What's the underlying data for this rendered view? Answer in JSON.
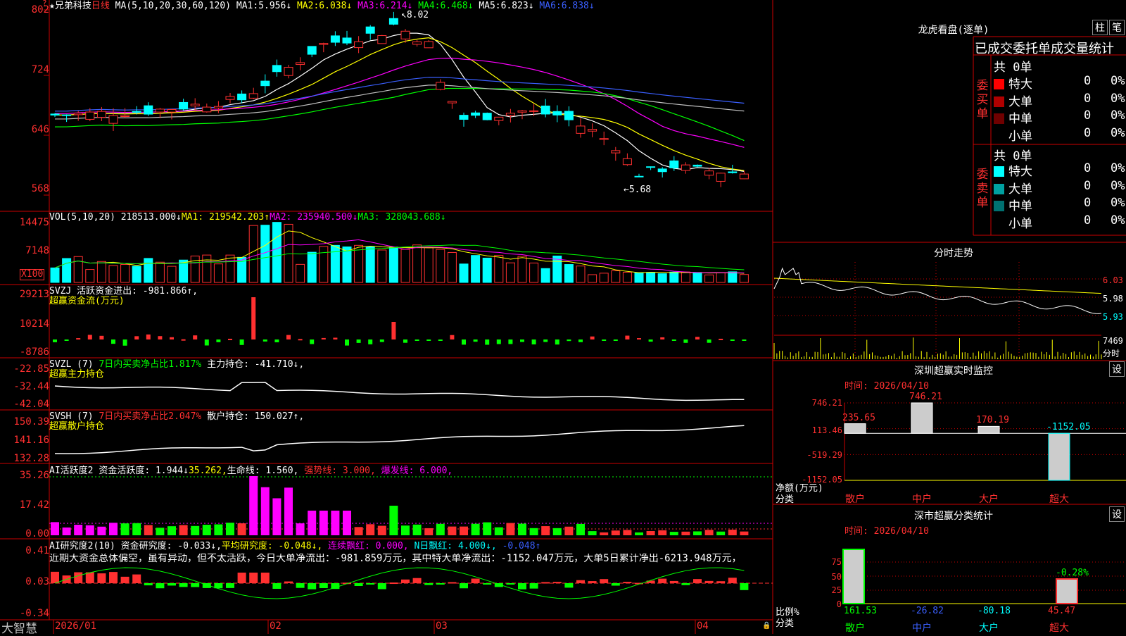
{
  "colors": {
    "up": "#ff3030",
    "down": "#00ffff",
    "grid": "#cc0000",
    "ma1": "#ffffff",
    "ma2": "#ffff00",
    "ma3": "#ff00ff",
    "ma4": "#00ff00",
    "ma5": "#3a5fff",
    "ma6": "#c0c0c0"
  },
  "kline": {
    "stock_name": "★兄弟科技",
    "period": "日线",
    "ma_label": "MA(5,10,20,30,60,120)",
    "ma_values": [
      {
        "label": "MA1:",
        "value": "5.956↓"
      },
      {
        "label": "MA2:",
        "value": "6.038↓"
      },
      {
        "label": "MA3:",
        "value": "6.214↓"
      },
      {
        "label": "MA4:",
        "value": "6.468↓"
      },
      {
        "label": "MA5:",
        "value": "6.823↓"
      },
      {
        "label": "MA6:",
        "value": "6.838↓"
      }
    ],
    "y_ticks": [
      "802",
      "724",
      "646",
      "568"
    ],
    "high_label": "8.02",
    "low_label": "5.68"
  },
  "vol": {
    "title": "VOL(5,10,20)",
    "value": "218513.000↓",
    "ma1": "MA1: 219542.203↑",
    "ma2": "MA2: 235940.500↓",
    "ma3": "MA3: 328043.688↓",
    "y_ticks": [
      "14475",
      "7148"
    ],
    "unit": "X100"
  },
  "svzj": {
    "title": "SVZJ",
    "desc": "活跃资金进出: -981.866↑,",
    "sub": "超赢资金流(万元)",
    "y_ticks": [
      "29213",
      "10214",
      "-8786"
    ]
  },
  "svzl": {
    "title": "SVZL (7)",
    "desc": "7日内买卖净占比1.817%",
    "desc2": "主力持仓: -41.710↓,",
    "sub": "超赢主力持仓",
    "y_ticks": [
      "-22.85",
      "-32.44",
      "-42.04"
    ]
  },
  "svsh": {
    "title": "SVSH (7)",
    "desc": "7日内买卖净占比2.047%",
    "desc2": "散户持仓: 150.027↑,",
    "sub": "超赢散户持仓",
    "y_ticks": [
      "150.39",
      "141.16",
      "132.28"
    ]
  },
  "ai1": {
    "title": "AI活跃度2",
    "a": "资金活跃度: 1.944↓",
    "b": "35.262,",
    "c": "生命线: 1.560,",
    "d": "强势线: 3.000,",
    "e": "爆发线: 6.000,",
    "y_ticks": [
      "35.26",
      "17.42",
      "0.00"
    ]
  },
  "ai2": {
    "title": "AI研究度2(10)",
    "a": "资金研究度: -0.033↓,",
    "b": "平均研究度: -0.048↓,",
    "c": "连续飘红: 0.000,",
    "d": "N日飘红: 4.000↓,",
    "e": "-0.048↑",
    "summary": "近期大资金总体偏空，虽有异动，但不太活跃，今日大单净流出：-981.859万元，其中特大单净流出：-1152.047万元，大单5日累计净出-6213.948万元，",
    "y_ticks": [
      "0.41",
      "0.03",
      "-0.34"
    ]
  },
  "dates": {
    "brand": "大智慧",
    "labels": [
      "2026/01",
      "02",
      "03",
      "04"
    ]
  },
  "lhb": {
    "title": "龙虎看盘(逐单)",
    "btn1": "柱",
    "btn2": "笔",
    "header": "已成交委托单成交量统计",
    "buy": {
      "side": [
        "委",
        "买",
        "单"
      ],
      "total": "共 0单",
      "rows": [
        {
          "name": "特大",
          "n": "0",
          "p": "0%",
          "c": "#ff0000"
        },
        {
          "name": "大单",
          "n": "0",
          "p": "0%",
          "c": "#b00000"
        },
        {
          "name": "中单",
          "n": "0",
          "p": "0%",
          "c": "#700000"
        },
        {
          "name": "小单",
          "n": "0",
          "p": "0%",
          "c": "#000000"
        }
      ]
    },
    "sell": {
      "side": [
        "委",
        "卖",
        "单"
      ],
      "total": "共 0单",
      "rows": [
        {
          "name": "特大",
          "n": "0",
          "p": "0%",
          "c": "#00ffff"
        },
        {
          "name": "大单",
          "n": "0",
          "p": "0%",
          "c": "#00a0a0"
        },
        {
          "name": "中单",
          "n": "0",
          "p": "0%",
          "c": "#007070"
        },
        {
          "name": "小单",
          "n": "0",
          "p": "0%",
          "c": "#000000"
        }
      ]
    }
  },
  "intraday": {
    "title": "分时走势",
    "price_ticks": [
      "6.03",
      "5.98",
      "5.93"
    ],
    "vol_tick": "7469",
    "vol_unit": "分时"
  },
  "monitor": {
    "title": "深圳超赢实时监控",
    "btn": "设",
    "time": "时间: 2026/04/10",
    "y_ticks": [
      "746.21",
      "113.46",
      "-519.29",
      "-1152.05"
    ],
    "axis_label": "净额(万元)",
    "axis_label2": "分类",
    "bars": [
      {
        "cat": "散户",
        "value": 235.65,
        "label": "235.65"
      },
      {
        "cat": "中户",
        "value": 746.21,
        "label": "746.21"
      },
      {
        "cat": "大户",
        "value": 170.19,
        "label": "170.19"
      },
      {
        "cat": "超大",
        "value": -1152.05,
        "label": "-1152.05"
      }
    ]
  },
  "classify": {
    "title": "深市超赢分类统计",
    "btn": "设",
    "time": "时间: 2026/04/10",
    "y_ticks": [
      "75",
      "50",
      "25",
      "0"
    ],
    "axis_label": "比例%",
    "axis_label2": "分类",
    "pct_label": "-0.28%",
    "cats": [
      {
        "name": "散户",
        "value": "161.53",
        "color": "#00ff00"
      },
      {
        "name": "中户",
        "value": "-26.82",
        "color": "#3a5fff"
      },
      {
        "name": "大户",
        "value": "-80.18",
        "color": "#00ffff"
      },
      {
        "name": "超大",
        "value": "45.47",
        "color": "#ff3030"
      }
    ]
  }
}
